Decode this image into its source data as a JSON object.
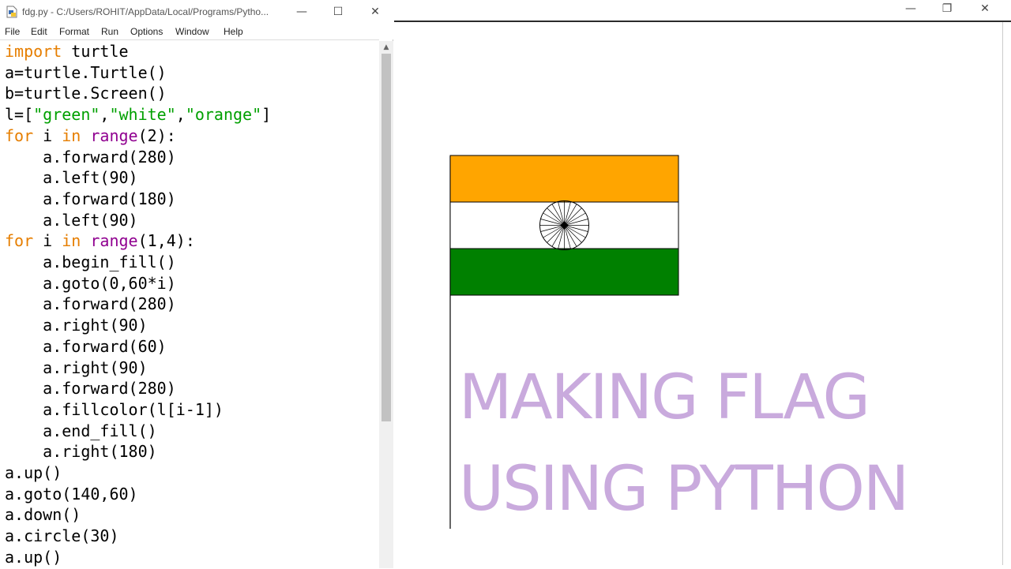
{
  "idle": {
    "title": "fdg.py - C:/Users/ROHIT/AppData/Local/Programs/Pytho...",
    "menu": [
      "File",
      "Edit",
      "Format",
      "Run",
      "Options",
      "Window",
      "Help"
    ],
    "code_lines": [
      "import turtle",
      "a=turtle.Turtle()",
      "b=turtle.Screen()",
      "l=[\"green\",\"white\",\"orange\"]",
      "for i in range(2):",
      "    a.forward(280)",
      "    a.left(90)",
      "    a.forward(180)",
      "    a.left(90)",
      "for i in range(1,4):",
      "    a.begin_fill()",
      "    a.goto(0,60*i)",
      "    a.forward(280)",
      "    a.right(90)",
      "    a.forward(60)",
      "    a.right(90)",
      "    a.forward(280)",
      "    a.fillcolor(l[i-1])",
      "    a.end_fill()",
      "    a.right(180)",
      "a.up()",
      "a.goto(140,60)",
      "a.down()",
      "a.circle(30)",
      "a.up()"
    ],
    "keywords": [
      "import",
      "for",
      "in"
    ],
    "builtins": [
      "range"
    ],
    "colors": {
      "keyword": "#e67e00",
      "builtin": "#900090",
      "string": "#00a000"
    }
  },
  "window_controls": {
    "minimize": "—",
    "maximize": "☐",
    "restore": "❐",
    "close": "✕"
  },
  "turtle_window": {
    "flag": {
      "stripes": [
        "orange",
        "white",
        "green"
      ],
      "stripe_colors": [
        "#ffa500",
        "#ffffff",
        "#008000"
      ],
      "chakra_spokes": 24
    }
  },
  "headline": {
    "line1": "MAKING FLAG",
    "line2": "USING PYTHON",
    "color": "#c9aadd"
  },
  "icons": {
    "file": "python-file-icon",
    "scroll_up": "scroll-up-arrow-icon"
  }
}
